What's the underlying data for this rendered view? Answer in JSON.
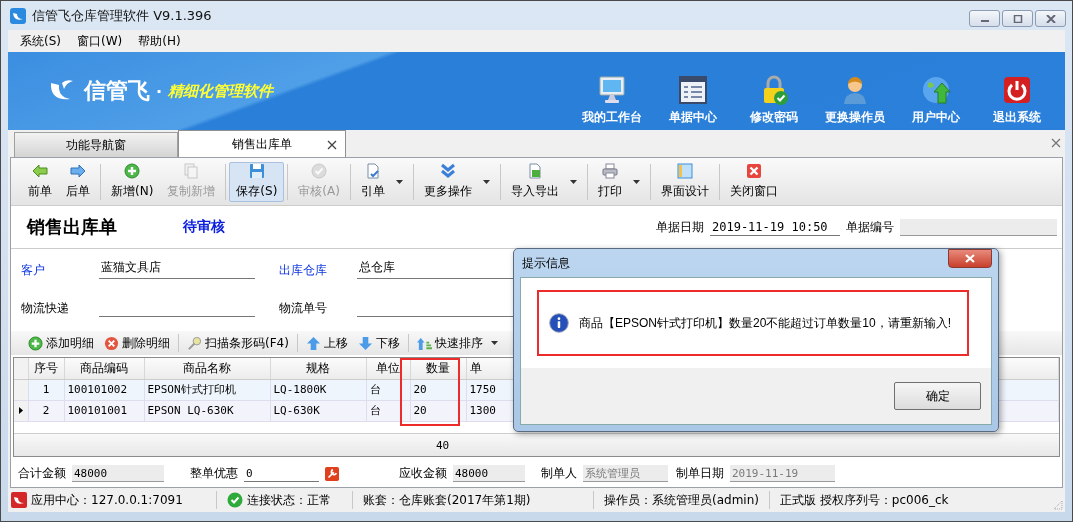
{
  "window": {
    "title": "信管飞仓库管理软件 V9.1.396"
  },
  "menu": [
    {
      "label": "系统(S)"
    },
    {
      "label": "窗口(W)"
    },
    {
      "label": "帮助(H)"
    }
  ],
  "banner": {
    "brand": "信管飞",
    "separator": "·",
    "slogan": "精细化管理软件",
    "actions": [
      {
        "label": "我的工作台"
      },
      {
        "label": "单据中心"
      },
      {
        "label": "修改密码"
      },
      {
        "label": "更换操作员"
      },
      {
        "label": "用户中心"
      },
      {
        "label": "退出系统"
      }
    ]
  },
  "tabs": [
    {
      "label": "功能导航窗",
      "selected": false,
      "closable": false
    },
    {
      "label": "销售出库单",
      "selected": true,
      "closable": true
    }
  ],
  "toolbar": {
    "groups": [
      {
        "buttons": [
          {
            "label": "前单",
            "disabled": false,
            "pressed": false,
            "has_menu": false
          },
          {
            "label": "后单",
            "disabled": false,
            "pressed": false,
            "has_menu": false
          }
        ]
      },
      {
        "buttons": [
          {
            "label": "新增(N)",
            "disabled": false,
            "pressed": false,
            "has_menu": false
          },
          {
            "label": "复制新增",
            "disabled": true,
            "pressed": false,
            "has_menu": false
          }
        ]
      },
      {
        "buttons": [
          {
            "label": "保存(S)",
            "disabled": false,
            "pressed": true,
            "has_menu": false
          }
        ]
      },
      {
        "buttons": [
          {
            "label": "审核(A)",
            "disabled": true,
            "pressed": false,
            "has_menu": false
          }
        ]
      },
      {
        "buttons": [
          {
            "label": "引单",
            "disabled": false,
            "pressed": false,
            "has_menu": true
          }
        ]
      },
      {
        "buttons": [
          {
            "label": "更多操作",
            "disabled": false,
            "pressed": false,
            "has_menu": true
          }
        ]
      },
      {
        "buttons": [
          {
            "label": "导入导出",
            "disabled": false,
            "pressed": false,
            "has_menu": true
          }
        ]
      },
      {
        "buttons": [
          {
            "label": "打印",
            "disabled": false,
            "pressed": false,
            "has_menu": true
          }
        ]
      },
      {
        "buttons": [
          {
            "label": "界面设计",
            "disabled": false,
            "pressed": false,
            "has_menu": false
          }
        ]
      },
      {
        "buttons": [
          {
            "label": "关闭窗口",
            "disabled": false,
            "pressed": false,
            "has_menu": false
          }
        ]
      }
    ]
  },
  "form": {
    "title": "销售出库单",
    "status": "待审核",
    "date_label": "单据日期",
    "date": "2019-11-19 10:50",
    "number_label": "单据编号",
    "fields": [
      {
        "label": "客户",
        "value": "蓝猫文具店",
        "required": true
      },
      {
        "label": "出库仓库",
        "value": "总仓库",
        "required": true
      },
      {
        "label": "物流快递",
        "required": false
      },
      {
        "label": "物流单号",
        "required": false
      }
    ]
  },
  "detail_toolbar": {
    "groups": [
      {
        "buttons": [
          {
            "label": "添加明细",
            "has_menu": false
          },
          {
            "label": "删除明细",
            "has_menu": false
          }
        ]
      },
      {
        "buttons": [
          {
            "label": "扫描条形码(F4)",
            "has_menu": false
          }
        ]
      },
      {
        "buttons": [
          {
            "label": "上移",
            "has_menu": false
          },
          {
            "label": "下移",
            "has_menu": false
          }
        ]
      },
      {
        "buttons": [
          {
            "label": "快速排序",
            "has_menu": true
          }
        ]
      }
    ]
  },
  "grid": {
    "columns": [
      {
        "label": "序号",
        "highlighted": false
      },
      {
        "label": "商品编码",
        "highlighted": false
      },
      {
        "label": "商品名称",
        "highlighted": false
      },
      {
        "label": "规格",
        "highlighted": false
      },
      {
        "label": "单位",
        "highlighted": false
      },
      {
        "label": "数量",
        "highlighted": true
      },
      {
        "label": "单",
        "highlighted": false
      }
    ],
    "rows": [
      {
        "selected": false,
        "cells": [
          "1",
          "100101002",
          "EPSON针式打印机",
          "LQ-1800K",
          "台",
          "20",
          "1750"
        ]
      },
      {
        "selected": true,
        "cells": [
          "2",
          "100101001",
          "EPSON LQ-630K",
          "LQ-630K",
          "台",
          "20",
          "1300"
        ]
      }
    ],
    "footer": {
      "quantity_total": "40"
    }
  },
  "totals": [
    {
      "label": "合计金额",
      "value": "48000",
      "kind": "readonly"
    },
    {
      "label": "整单优惠",
      "value": "0",
      "kind": "input"
    },
    {
      "label": "应收金额",
      "value": "48000",
      "kind": "readonly"
    },
    {
      "label": "制单人",
      "value": "系统管理员",
      "kind": "disabled"
    },
    {
      "label": "制单日期",
      "value": "2019-11-19",
      "kind": "disabled"
    }
  ],
  "status_bar": [
    {
      "text": "应用中心：127.0.0.1:7091"
    },
    {
      "text": "连接状态：正常"
    },
    {
      "text": "账套：仓库账套(2017年第1期)"
    },
    {
      "text": "操作员：系统管理员(admin)"
    },
    {
      "text": "正式版 授权序列号：pc006_ck"
    }
  ],
  "dialog": {
    "title": "提示信息",
    "message": "商品【EPSON针式打印机】数量20不能超过订单数量10，请重新输入!",
    "highlighted": true,
    "button": "确定"
  }
}
